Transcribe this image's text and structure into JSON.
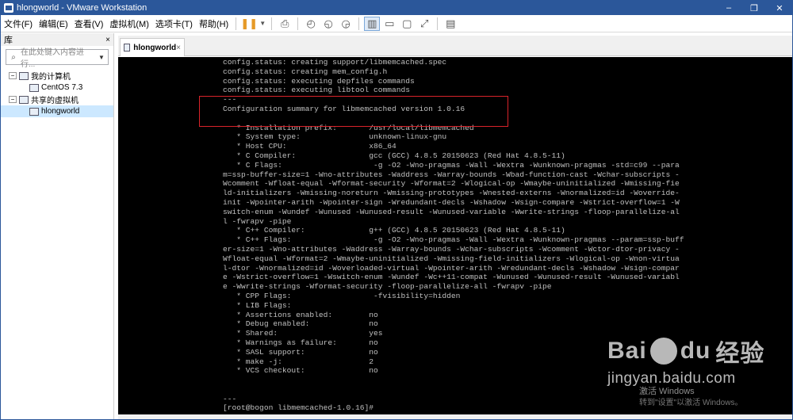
{
  "window": {
    "title": "hlongworld - VMware Workstation",
    "controls": [
      "–",
      "❐",
      "✕"
    ]
  },
  "menu": [
    "文件(F)",
    "编辑(E)",
    "查看(V)",
    "虚拟机(M)",
    "选项卡(T)",
    "帮助(H)"
  ],
  "sidebar": {
    "header": "库",
    "close": "×",
    "search_placeholder": "在此处键入内容进行...",
    "tree": [
      {
        "toggle": "−",
        "label": "我的计算机",
        "level": 0
      },
      {
        "label": "CentOS 7.3",
        "level": 1
      },
      {
        "toggle": "−",
        "label": "共享的虚拟机",
        "level": 0
      },
      {
        "label": "hlongworld",
        "level": 1,
        "selected": true
      }
    ]
  },
  "tab": {
    "label": "hlongworld",
    "close": "×"
  },
  "console": {
    "lines": [
      "config.status: creating support/libmemcached.spec",
      "config.status: creating mem_config.h",
      "config.status: executing depfiles commands",
      "config.status: executing libtool commands",
      "---",
      "Configuration summary for libmemcached version 1.0.16",
      "",
      "   * Installation prefix:       /usr/local/libmemcached",
      "   * System type:               unknown-linux-gnu",
      "   * Host CPU:                  x86_64",
      "   * C Compiler:                gcc (GCC) 4.8.5 20150623 (Red Hat 4.8.5-11)",
      "   * C Flags:                    -g -O2 -Wno-pragmas -Wall -Wextra -Wunknown-pragmas -std=c99 --para",
      "m=ssp-buffer-size=1 -Wno-attributes -Waddress -Warray-bounds -Wbad-function-cast -Wchar-subscripts -",
      "Wcomment -Wfloat-equal -Wformat-security -Wformat=2 -Wlogical-op -Wmaybe-uninitialized -Wmissing-fie",
      "ld-initializers -Wmissing-noreturn -Wmissing-prototypes -Wnested-externs -Wnormalized=id -Woverride-",
      "init -Wpointer-arith -Wpointer-sign -Wredundant-decls -Wshadow -Wsign-compare -Wstrict-overflow=1 -W",
      "switch-enum -Wundef -Wunused -Wunused-result -Wunused-variable -Wwrite-strings -floop-parallelize-al",
      "l -fwrapv -pipe",
      "   * C++ Compiler:              g++ (GCC) 4.8.5 20150623 (Red Hat 4.8.5-11)",
      "   * C++ Flags:                  -g -O2 -Wno-pragmas -Wall -Wextra -Wunknown-pragmas --param=ssp-buff",
      "er-size=1 -Wno-attributes -Waddress -Warray-bounds -Wchar-subscripts -Wcomment -Wctor-dtor-privacy -",
      "Wfloat-equal -Wformat=2 -Wmaybe-uninitialized -Wmissing-field-initializers -Wlogical-op -Wnon-virtua",
      "l-dtor -Wnormalized=id -Woverloaded-virtual -Wpointer-arith -Wredundant-decls -Wshadow -Wsign-compar",
      "e -Wstrict-overflow=1 -Wswitch-enum -Wundef -Wc++11-compat -Wunused -Wunused-result -Wunused-variabl",
      "e -Wwrite-strings -Wformat-security -floop-parallelize-all -fwrapv -pipe",
      "   * CPP Flags:                  -fvisibility=hidden",
      "   * LIB Flags:",
      "   * Assertions enabled:        no",
      "   * Debug enabled:             no",
      "   * Shared:                    yes",
      "   * Warnings as failure:       no",
      "   * SASL support:              no",
      "   * make -j:                   2",
      "   * VCS checkout:              no",
      "",
      "",
      "---",
      "[root@bogon libmemcached-1.0.16]#"
    ]
  },
  "watermark": {
    "logo_a": "Bai",
    "logo_b": "du",
    "logo_c": "经验",
    "url": "jingyan.baidu.com",
    "activate_1": "激活 Windows",
    "activate_2": "转到\"设置\"以激活 Windows。"
  }
}
